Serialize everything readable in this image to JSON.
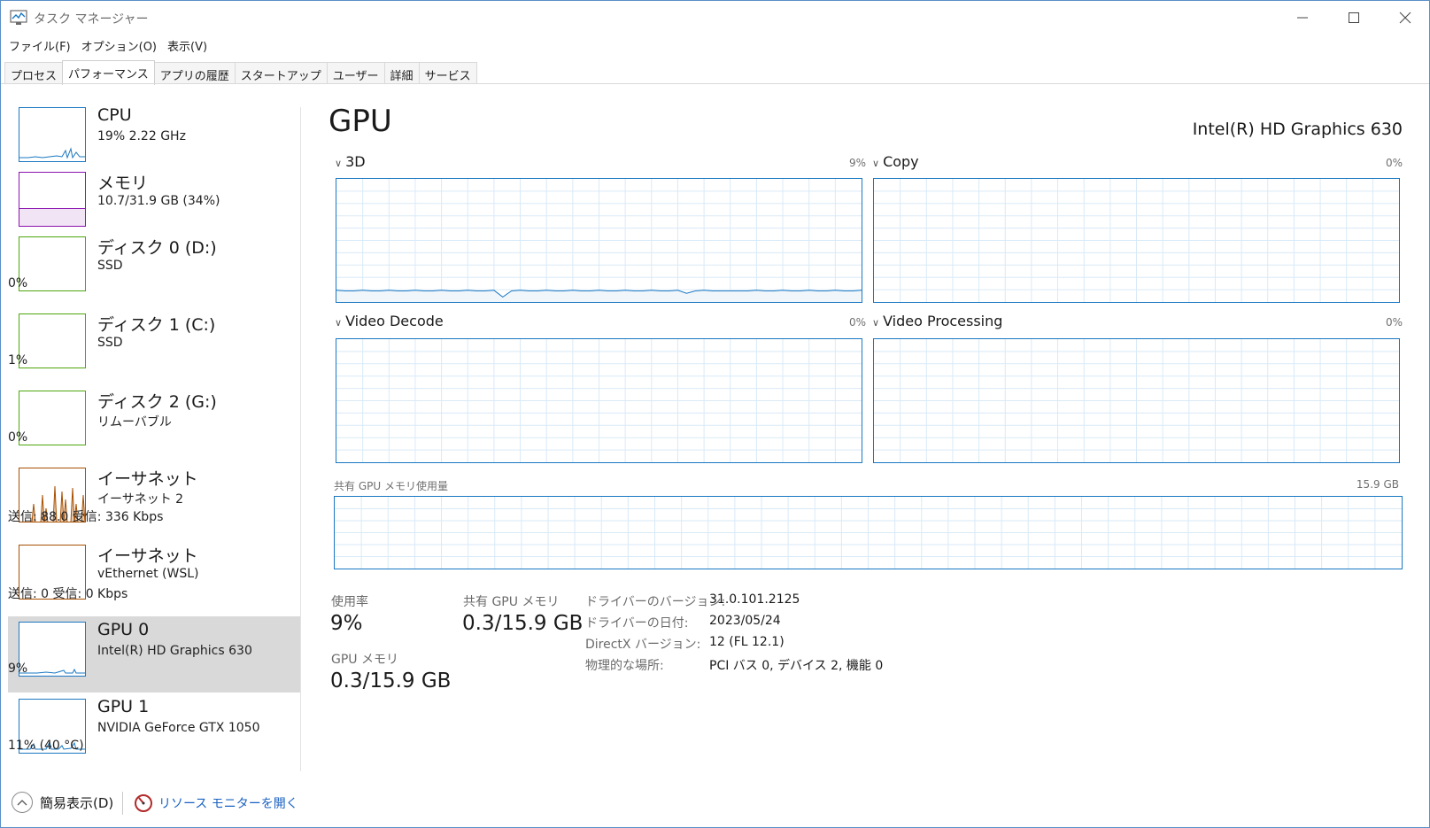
{
  "window": {
    "title": "タスク マネージャー"
  },
  "menu": [
    "ファイル(F)",
    "オプション(O)",
    "表示(V)"
  ],
  "tabs": [
    {
      "label": "プロセス",
      "active": false
    },
    {
      "label": "パフォーマンス",
      "active": true
    },
    {
      "label": "アプリの履歴",
      "active": false
    },
    {
      "label": "スタートアップ",
      "active": false
    },
    {
      "label": "ユーザー",
      "active": false
    },
    {
      "label": "詳細",
      "active": false
    },
    {
      "label": "サービス",
      "active": false
    }
  ],
  "sidebar": [
    {
      "name": "CPU",
      "line1": "19% 2.22 GHz",
      "line2": "",
      "color": "#1a78c2",
      "usage": 19
    },
    {
      "name": "メモリ",
      "line1": "10.7/31.9 GB (34%)",
      "line2": "",
      "color": "#8b12ae",
      "usage": 34
    },
    {
      "name": "ディスク 0 (D:)",
      "line1": "SSD",
      "line2": "0%",
      "color": "#4da60c",
      "usage": 0
    },
    {
      "name": "ディスク 1 (C:)",
      "line1": "SSD",
      "line2": "1%",
      "color": "#4da60c",
      "usage": 1
    },
    {
      "name": "ディスク 2 (G:)",
      "line1": "リムーバブル",
      "line2": "0%",
      "color": "#4da60c",
      "usage": 0
    },
    {
      "name": "イーサネット",
      "line1": "イーサネット 2",
      "line2": "送信: 88.0 受信: 336 Kbps",
      "color": "#a74f01"
    },
    {
      "name": "イーサネット",
      "line1": "vEthernet (WSL)",
      "line2": "送信: 0 受信: 0 Kbps",
      "color": "#a74f01"
    },
    {
      "name": "GPU 0",
      "line1": "Intel(R) HD Graphics 630",
      "line2": "9%",
      "color": "#1a78c2",
      "usage": 9,
      "selected": true
    },
    {
      "name": "GPU 1",
      "line1": "NVIDIA GeForce GTX 1050",
      "line2": "11% (40 °C)",
      "color": "#1a78c2",
      "usage": 11
    }
  ],
  "main": {
    "title": "GPU",
    "adapter": "Intel(R) HD Graphics 630",
    "graphs": [
      {
        "label": "3D",
        "pct": "9%"
      },
      {
        "label": "Copy",
        "pct": "0%"
      },
      {
        "label": "Video Decode",
        "pct": "0%"
      },
      {
        "label": "Video Processing",
        "pct": "0%"
      }
    ],
    "shared_memory": {
      "label": "共有 GPU メモリ使用量",
      "max": "15.9 GB"
    },
    "stats": {
      "usage_label": "使用率",
      "usage_value": "9%",
      "gpu_mem_label": "GPU メモリ",
      "gpu_mem_value": "0.3/15.9 GB",
      "shared_mem_label": "共有 GPU メモリ",
      "shared_mem_value": "0.3/15.9 GB"
    },
    "info": [
      {
        "key": "ドライバーのバージョン:",
        "value": "31.0.101.2125"
      },
      {
        "key": "ドライバーの日付:",
        "value": "2023/05/24"
      },
      {
        "key": "DirectX バージョン:",
        "value": "12 (FL 12.1)"
      },
      {
        "key": "物理的な場所:",
        "value": "PCI バス 0, デバイス 2, 機能 0"
      }
    ]
  },
  "footer": {
    "fewer_details": "簡易表示(D)",
    "open_resmon": "リソース モニターを開く"
  }
}
